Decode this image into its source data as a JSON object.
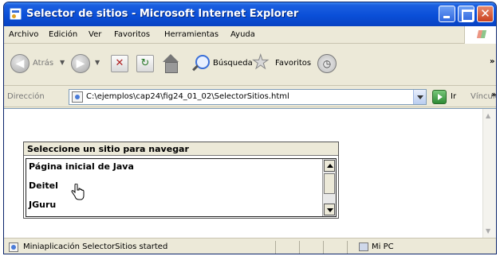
{
  "window": {
    "title": "Selector de sitios - Microsoft Internet Explorer"
  },
  "menu": {
    "items": [
      "Archivo",
      "Edición",
      "Ver",
      "Favoritos",
      "Herramientas",
      "Ayuda"
    ]
  },
  "toolbar": {
    "back_label": "Atrás",
    "search_label": "Búsqueda",
    "favorites_label": "Favoritos"
  },
  "address": {
    "label": "Dirección",
    "url": "C:\\ejemplos\\cap24\\fig24_01_02\\SelectorSitios.html",
    "go_label": "Ir",
    "links_label": "Vínculos"
  },
  "applet": {
    "label": "Seleccione un sitio para navegar",
    "sites": [
      "Página inicial de Java",
      "Deitel",
      "JGuru"
    ]
  },
  "status": {
    "text": "Miniaplicación SelectorSitios started",
    "zone": "Mi PC"
  }
}
